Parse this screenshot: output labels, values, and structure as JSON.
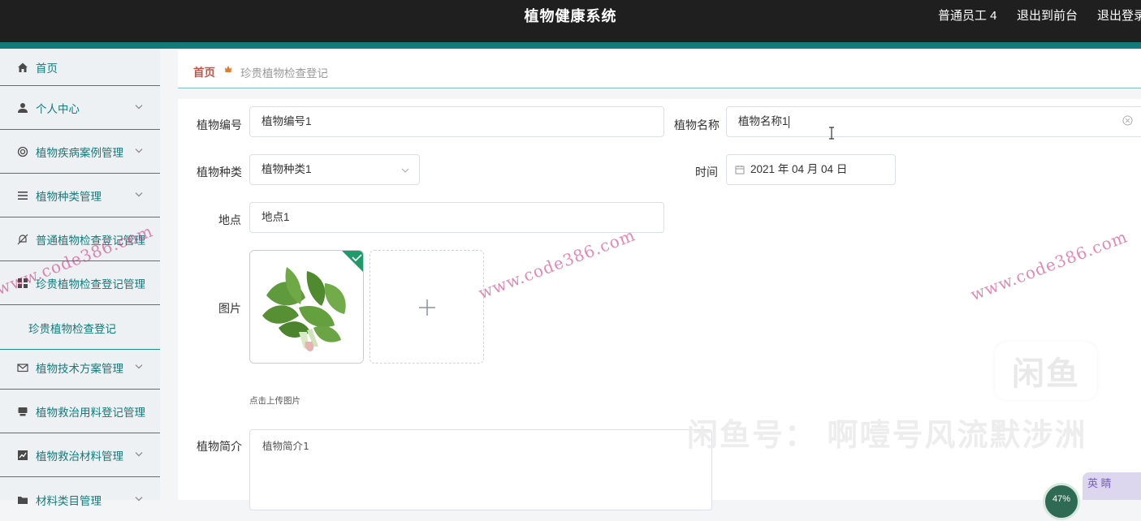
{
  "header": {
    "title": "植物健康系统",
    "user": "普通员工 4",
    "back_to_front": "退出到前台",
    "logout": "退出登录"
  },
  "sidebar": {
    "items": [
      {
        "label": "首页",
        "icon": "home-icon"
      },
      {
        "label": "个人中心",
        "icon": "user-icon"
      },
      {
        "label": "植物疾病案例管理",
        "icon": "target-icon"
      },
      {
        "label": "植物种类管理",
        "icon": "list-icon"
      },
      {
        "label": "普通植物检查登记管理",
        "icon": "bell-off-icon"
      },
      {
        "label": "珍贵植物检查登记管理",
        "icon": "grid-icon"
      },
      {
        "label": "植物技术方案管理",
        "icon": "mail-icon"
      },
      {
        "label": "植物救治用料登记管理",
        "icon": "box-icon"
      },
      {
        "label": "植物救治材料管理",
        "icon": "chart-icon"
      },
      {
        "label": "材料类目管理",
        "icon": "folder-icon"
      }
    ],
    "sub_item": "珍贵植物检查登记"
  },
  "breadcrumb": {
    "home": "首页",
    "current": "珍贵植物检查登记"
  },
  "form": {
    "code_label": "植物编号",
    "code_value": "植物编号1",
    "name_label": "植物名称",
    "name_value": "植物名称1",
    "type_label": "植物种类",
    "type_value": "植物种类1",
    "time_label": "时间",
    "time_value": "2021 年 04 月 04 日",
    "place_label": "地点",
    "place_value": "地点1",
    "image_label": "图片",
    "upload_hint": "点击上传图片",
    "intro_label": "植物简介",
    "intro_value": "植物简介1"
  },
  "overlay": {
    "watermark": "www.code386.com",
    "xianyu_logo": "闲鱼",
    "xianyu_text": "闲鱼号： 啊噎号风流默涉洲",
    "badge": "47%",
    "ime": "英 睛"
  },
  "colors": {
    "teal": "#137a7a",
    "topbar": "#1f1f1f",
    "breadcrumb_home": "#c0574a"
  }
}
